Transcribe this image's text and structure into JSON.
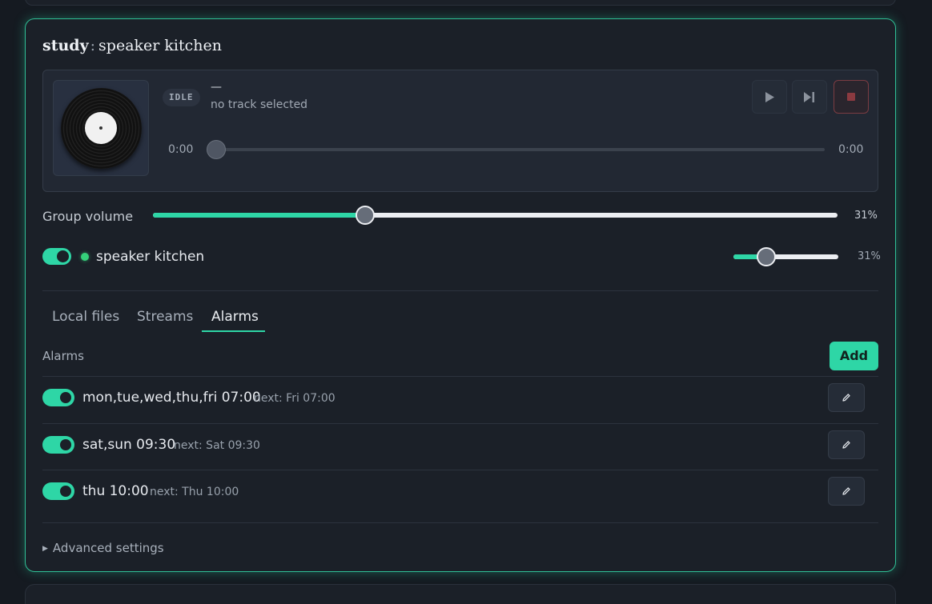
{
  "group": {
    "room": "study",
    "separator": ":",
    "speaker_title": "speaker kitchen"
  },
  "player": {
    "state_badge": "IDLE",
    "track_title": "—",
    "track_subtitle": "no track selected",
    "time_elapsed": "0:00",
    "time_total": "0:00",
    "progress": 0
  },
  "group_volume": {
    "label": "Group volume",
    "value_text": "31%",
    "level": 0.31
  },
  "speaker": {
    "name": "speaker kitchen",
    "enabled": true,
    "online": true,
    "volume_text": "31%",
    "level": 0.31
  },
  "tabs": [
    {
      "label": "Local files",
      "active": false
    },
    {
      "label": "Streams",
      "active": false
    },
    {
      "label": "Alarms",
      "active": true
    }
  ],
  "alarms": {
    "heading": "Alarms",
    "add_label": "Add",
    "items": [
      {
        "schedule": "mon,tue,wed,thu,fri 07:00",
        "next": "next: Fri 07:00",
        "enabled": true
      },
      {
        "schedule": "sat,sun 09:30",
        "next": "next: Sat 09:30",
        "enabled": true
      },
      {
        "schedule": "thu 10:00",
        "next": "next: Thu 10:00",
        "enabled": true
      }
    ]
  },
  "advanced": {
    "label": "Advanced settings"
  },
  "colors": {
    "accent": "#2ed6a6",
    "card_bg": "#1b2028",
    "page_bg": "#151a21",
    "status_online": "#35d07a",
    "stop_red": "#8b3a40"
  },
  "icons": {
    "play": "play-icon",
    "next": "skip-next-icon",
    "stop": "stop-icon",
    "edit": "pencil-icon",
    "advanced": "caret-right-icon"
  }
}
